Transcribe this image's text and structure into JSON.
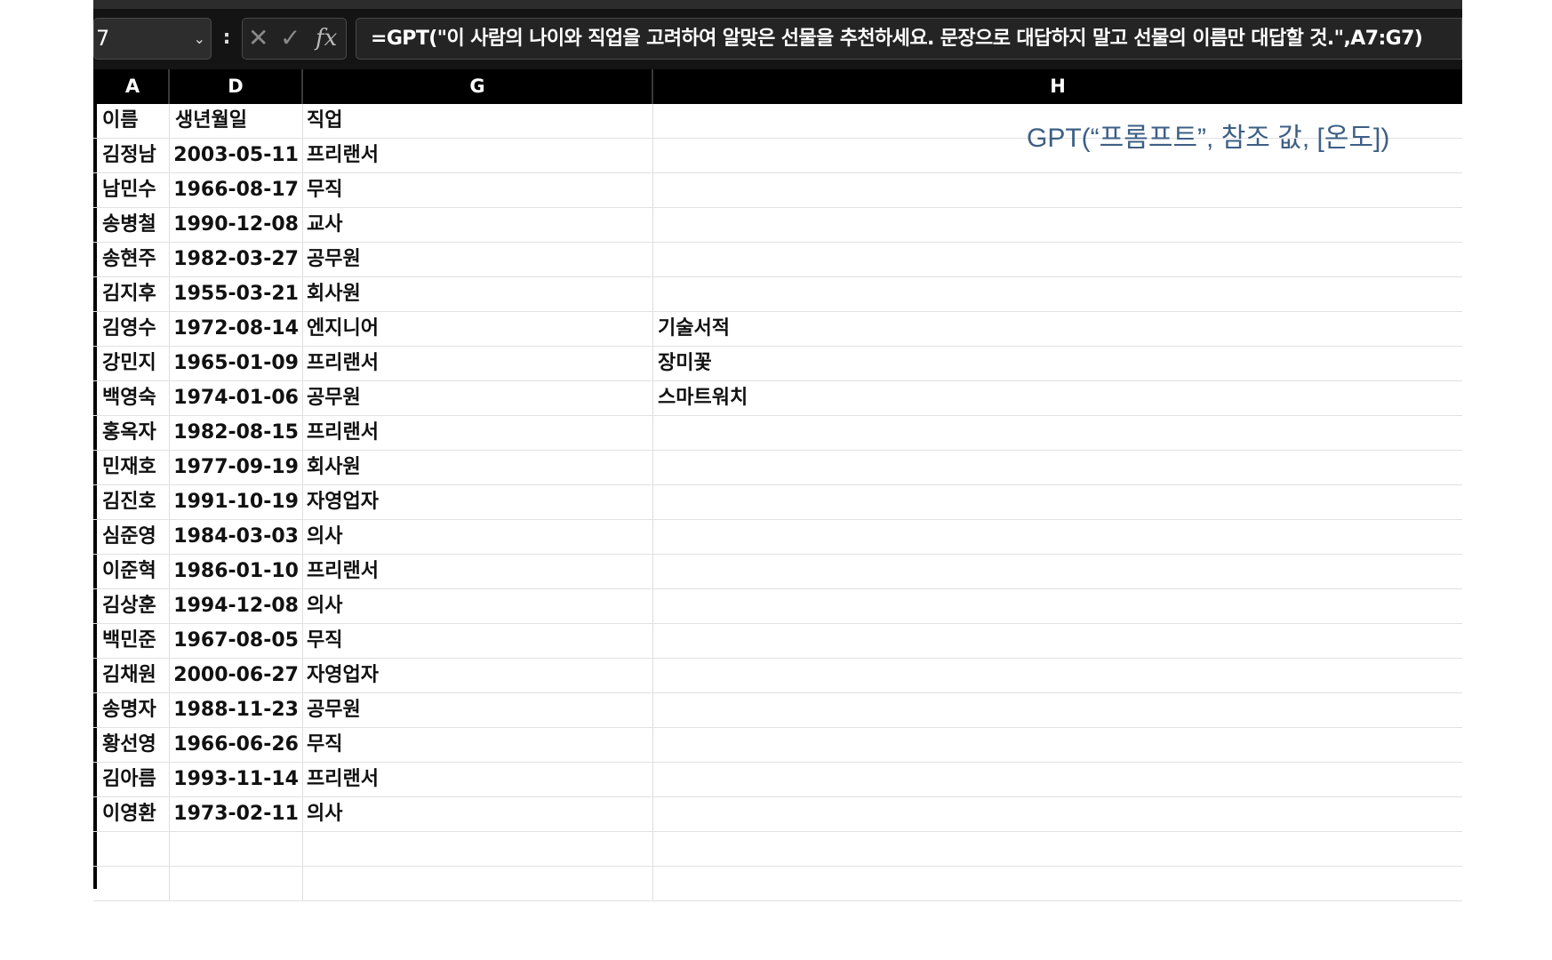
{
  "name_box": {
    "value": "7"
  },
  "formula_bar": {
    "more_label": ":",
    "cancel_glyph": "✕",
    "enter_glyph": "✓",
    "fx_label": "fx",
    "formula": "=GPT(\"이 사람의 나이와 직업을 고려하여 알맞은 선물을 추천하세요. 문장으로 대답하지 말고 선물의 이름만 대답할 것.\",A7:G7)"
  },
  "columns": [
    "A",
    "D",
    "G",
    "H"
  ],
  "header_row": {
    "A": "이름",
    "D": "생년월일",
    "G": "직업",
    "H": ""
  },
  "rows": [
    {
      "name": "김정남",
      "birth": "2003-05-11",
      "job": "프리랜서",
      "gift": ""
    },
    {
      "name": "남민수",
      "birth": "1966-08-17",
      "job": "무직",
      "gift": ""
    },
    {
      "name": "송병철",
      "birth": "1990-12-08",
      "job": "교사",
      "gift": ""
    },
    {
      "name": "송현주",
      "birth": "1982-03-27",
      "job": "공무원",
      "gift": ""
    },
    {
      "name": "김지후",
      "birth": "1955-03-21",
      "job": "회사원",
      "gift": ""
    },
    {
      "name": "김영수",
      "birth": "1972-08-14",
      "job": "엔지니어",
      "gift": "기술서적"
    },
    {
      "name": "강민지",
      "birth": "1965-01-09",
      "job": "프리랜서",
      "gift": "장미꽃"
    },
    {
      "name": "백영숙",
      "birth": "1974-01-06",
      "job": "공무원",
      "gift": "스마트워치"
    },
    {
      "name": "홍옥자",
      "birth": "1982-08-15",
      "job": "프리랜서",
      "gift": ""
    },
    {
      "name": "민재호",
      "birth": "1977-09-19",
      "job": "회사원",
      "gift": ""
    },
    {
      "name": "김진호",
      "birth": "1991-10-19",
      "job": "자영업자",
      "gift": ""
    },
    {
      "name": "심준영",
      "birth": "1984-03-03",
      "job": "의사",
      "gift": ""
    },
    {
      "name": "이준혁",
      "birth": "1986-01-10",
      "job": "프리랜서",
      "gift": ""
    },
    {
      "name": "김상훈",
      "birth": "1994-12-08",
      "job": "의사",
      "gift": ""
    },
    {
      "name": "백민준",
      "birth": "1967-08-05",
      "job": "무직",
      "gift": ""
    },
    {
      "name": "김채원",
      "birth": "2000-06-27",
      "job": "자영업자",
      "gift": ""
    },
    {
      "name": "송명자",
      "birth": "1988-11-23",
      "job": "공무원",
      "gift": ""
    },
    {
      "name": "황선영",
      "birth": "1966-06-26",
      "job": "무직",
      "gift": ""
    },
    {
      "name": "김아름",
      "birth": "1993-11-14",
      "job": "프리랜서",
      "gift": ""
    },
    {
      "name": "이영환",
      "birth": "1973-02-11",
      "job": "의사",
      "gift": ""
    }
  ],
  "syntax_note": "GPT(“프롬프트”, 참조 값, [온도])"
}
